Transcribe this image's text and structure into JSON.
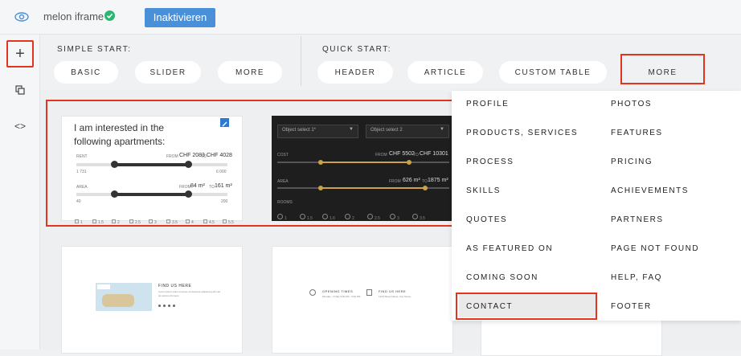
{
  "topbar": {
    "site_name": "melon iframe",
    "deactivate_label": "Inaktivieren",
    "icons": {
      "preview": "eye-icon",
      "status": "check-circle-icon"
    }
  },
  "leftbar": {
    "icons": [
      "plus-icon",
      "copy-icon",
      "code-icon"
    ],
    "plus_glyph": "+",
    "code_glyph": "<>"
  },
  "simple_start": {
    "label": "SIMPLE START:",
    "items": [
      "BASIC",
      "SLIDER",
      "MORE"
    ]
  },
  "quick_start": {
    "label": "QUICK START:",
    "items": [
      "HEADER",
      "ARTICLE",
      "CUSTOM TABLE",
      "MORE"
    ]
  },
  "dropdown": {
    "left": [
      "PROFILE",
      "PRODUCTS, SERVICES",
      "PROCESS",
      "SKILLS",
      "QUOTES",
      "AS FEATURED ON",
      "COMING SOON",
      "CONTACT"
    ],
    "right": [
      "PHOTOS",
      "FEATURES",
      "PRICING",
      "ACHIEVEMENTS",
      "PARTNERS",
      "PAGE NOT FOUND",
      "HELP, FAQ",
      "FOOTER"
    ],
    "selected": "CONTACT"
  },
  "cards": {
    "slider_white": {
      "title": "I am interested in the following apartments:",
      "rent_label": "RENT",
      "rent_from": "FROM",
      "rent_min": "CHF 2083",
      "rent_to": "TO",
      "rent_max": "CHF 4028",
      "rent_scale_min": "1 731",
      "rent_scale_max": "6 000",
      "area_label": "AREA",
      "area_from": "FROM",
      "area_min": "84 m²",
      "area_to": "TO",
      "area_max": "161 m²",
      "area_scale_min": "40",
      "area_scale_max": "200",
      "rooms": [
        "1",
        "1.5",
        "2",
        "2.5",
        "3",
        "3.5",
        "4",
        "4.5",
        "5.5"
      ],
      "rent_thumb_positions_pct": [
        0.25,
        0.75
      ],
      "area_thumb_positions_pct": [
        0.25,
        0.75
      ]
    },
    "slider_dark": {
      "select1": "Object select 1*",
      "select2": "Object select 2",
      "cost_label": "COST",
      "cost_from": "FROM",
      "cost_min": "CHF 5502",
      "cost_to": "TO",
      "cost_max": "CHF 10301",
      "area_label": "AREA",
      "area_from": "FROM",
      "area_min": "626 m²",
      "area_to": "TO",
      "area_max": "1875 m²",
      "rooms_label": "ROOMS",
      "rooms": [
        "1",
        "1.5",
        "1.6",
        "2",
        "2.5",
        "3",
        "3.5"
      ]
    },
    "contact_map": {
      "heading": "FIND US HERE",
      "text": "Lorem ipsum dolor sit amet consectetur adipiscing elit sed do eiusmod tempor"
    },
    "contact_times": {
      "times_heading": "OPENING TIMES",
      "times_text": "Monday - Friday 9:00 AM - 5:00 PM",
      "find_heading": "FIND US HERE",
      "find_text": "1234 Street Name, City Name"
    }
  },
  "colors": {
    "accent": "#4a90d9",
    "highlight": "#e3351e",
    "status_green": "#2bb672",
    "dark_card": "#1e1e1e",
    "gold": "#c9a24a"
  }
}
